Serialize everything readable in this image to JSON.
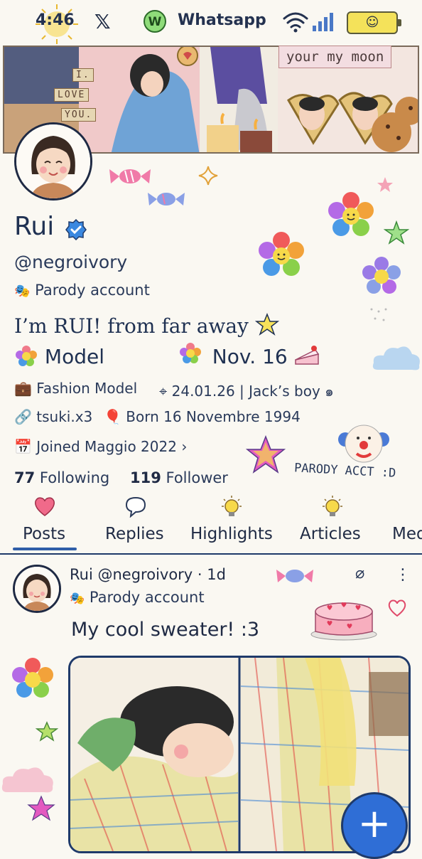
{
  "status_bar": {
    "time": "4:46",
    "x_icon": "x-logo",
    "whatsapp_icon_letter": "W",
    "whatsapp_label": "Whatsapp",
    "battery_face": "☺"
  },
  "banner": {
    "caption": "your my moon",
    "note_lines": [
      "I.",
      "LOVE",
      "YOU."
    ]
  },
  "profile": {
    "name": "Rui",
    "handle": "@negroivory",
    "parody_label": "Parody account",
    "bio_line_1": "I’m RUI! from far away",
    "bio_model": "Model",
    "bio_date": "Nov. 16",
    "occupation": "Fashion Model",
    "location": "24.01.26 | Jack’s boy",
    "link": "tsuki.x3",
    "birth": "Born 16 Novembre 1994",
    "joined": "Joined Maggio 2022",
    "following_count": "77",
    "following_label": "Following",
    "follower_count": "119",
    "follower_label": "Follower",
    "sticker_text": "PARODY ACCT :D"
  },
  "tabs": [
    {
      "label": "Posts",
      "icon": "heart-icon",
      "active": true
    },
    {
      "label": "Replies",
      "icon": "speech-bubble-icon",
      "active": false
    },
    {
      "label": "Highlights",
      "icon": "lightbulb-icon",
      "active": false
    },
    {
      "label": "Articles",
      "icon": "lightbulb-icon",
      "active": false
    },
    {
      "label": "Med",
      "icon": "",
      "active": false
    }
  ],
  "post": {
    "author": "Rui",
    "handle_time": "@negroivory · 1d",
    "parody_label": "Parody account",
    "text": "My cool sweater! :3",
    "more_icon": "more-icon"
  },
  "fab": {
    "label": "+"
  },
  "colors": {
    "accent": "#2f5ea8",
    "fab": "#2f6ed6",
    "background": "#faf8f2",
    "text": "#1f2a44"
  }
}
